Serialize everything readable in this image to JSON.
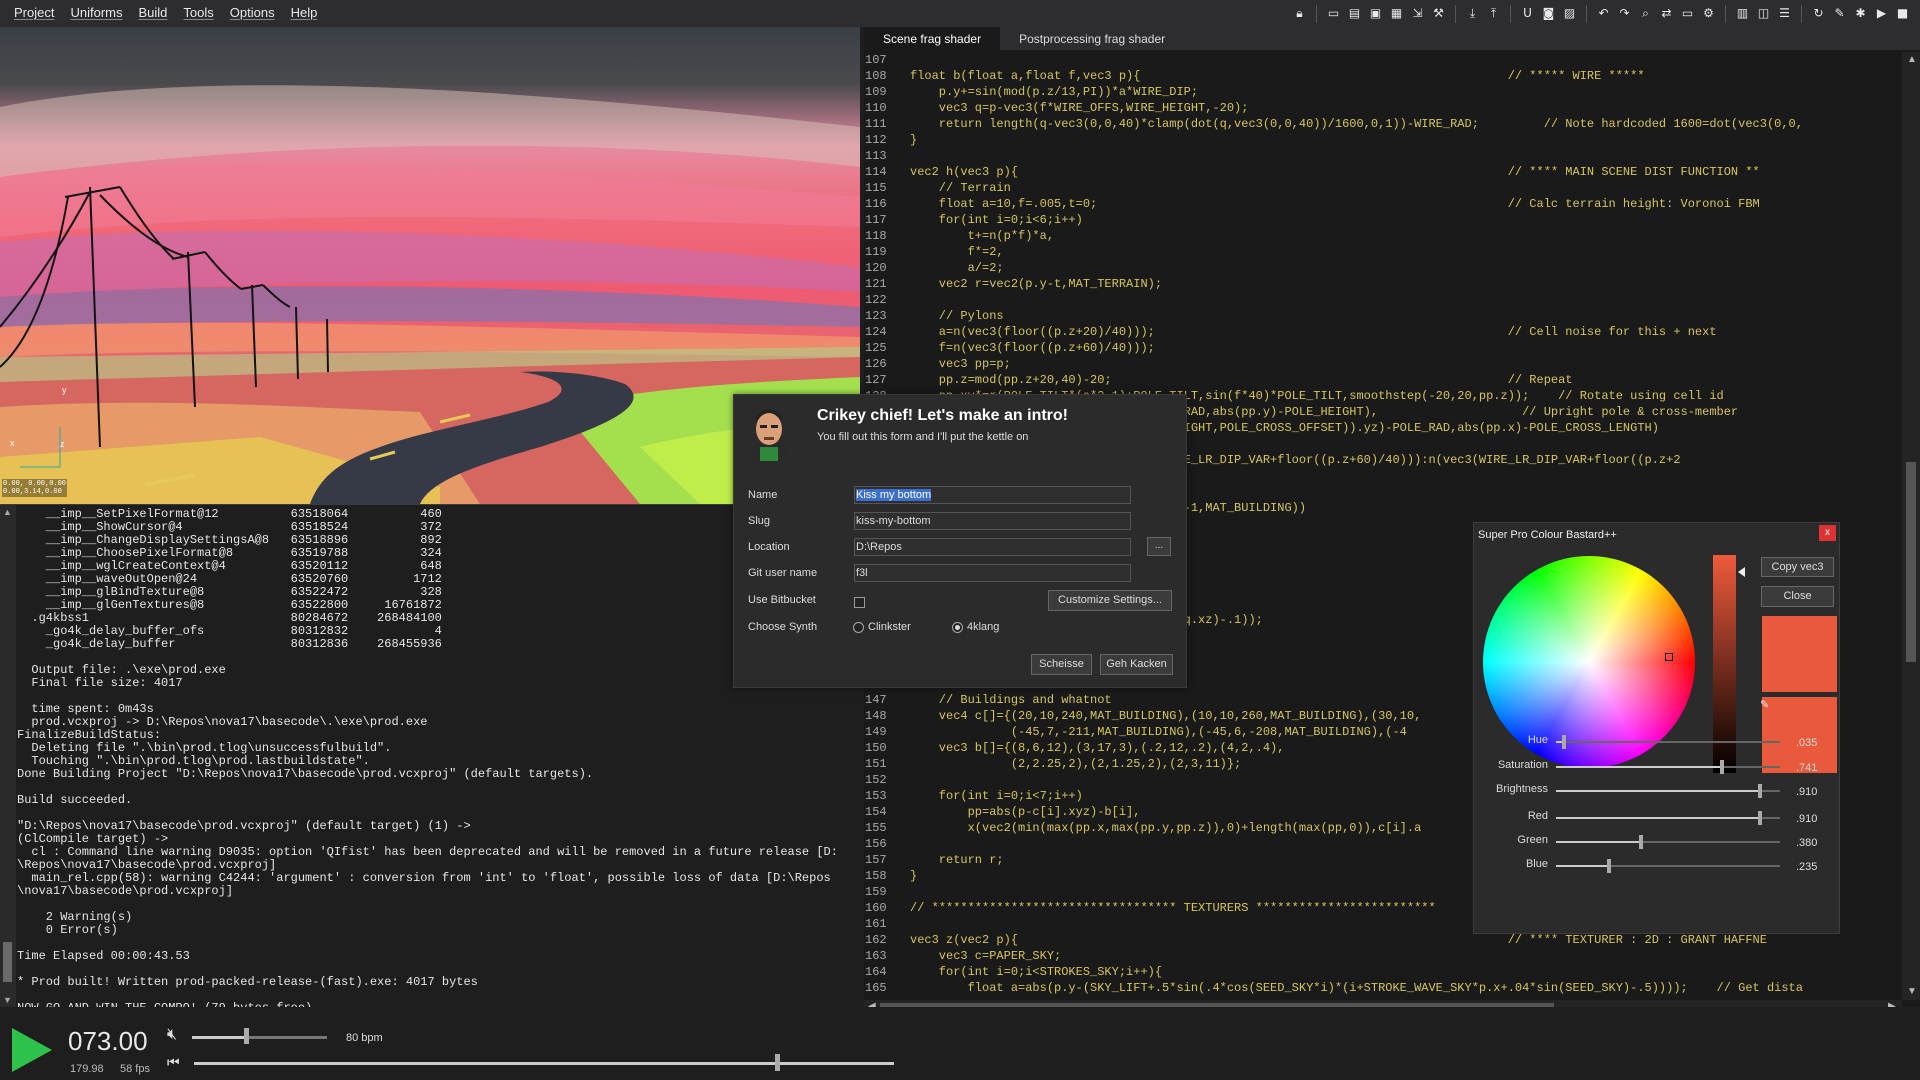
{
  "menu": [
    "Project",
    "Uniforms",
    "Build",
    "Tools",
    "Options",
    "Help"
  ],
  "toolbar_icons": [
    "lock-icon",
    "new-file-icon",
    "open-icon",
    "save-icon",
    "save-as-icon",
    "export-icon",
    "build-icon",
    "pin-icon",
    "reload-icon",
    "underline-icon",
    "camera-icon",
    "image-icon",
    "undo-icon",
    "redo-icon",
    "search-icon",
    "replace-icon",
    "monitor-icon",
    "settings-icon",
    "layout-icon",
    "split-icon",
    "list-icon",
    "refresh-icon",
    "wrench-icon",
    "bug-icon",
    "play-icon",
    "stop-icon"
  ],
  "viewport": {
    "coords_line1": "0.00, 0.00,0.00",
    "coords_line2": "0.00,3.14,0.00",
    "axis_x": "x",
    "axis_y": "y",
    "axis_z": "z"
  },
  "console": {
    "lines": [
      "    __imp__SetPixelFormat@12          63518064          460",
      "    __imp__ShowCursor@4               63518524          372",
      "    __imp__ChangeDisplaySettingsA@8   63518896          892",
      "    __imp__ChoosePixelFormat@8        63519788          324",
      "    __imp__wglCreateContext@4         63520112          648",
      "    __imp__waveOutOpen@24             63520760         1712",
      "    __imp__glBindTexture@8            63522472          328",
      "    __imp__glGenTextures@8            63522800     16761872",
      "  .g4kbss1                            80284672    268484100",
      "    _go4k_delay_buffer_ofs            80312832            4",
      "    _go4k_delay_buffer                80312836    268455936",
      "",
      "  Output file: .\\exe\\prod.exe",
      "  Final file size: 4017",
      "",
      "  time spent: 0m43s",
      "  prod.vcxproj -> D:\\Repos\\nova17\\basecode\\.\\exe\\prod.exe",
      "FinalizeBuildStatus:",
      "  Deleting file \".\\bin\\prod.tlog\\unsuccessfulbuild\".",
      "  Touching \".\\bin\\prod.tlog\\prod.lastbuildstate\".",
      "Done Building Project \"D:\\Repos\\nova17\\basecode\\prod.vcxproj\" (default targets).",
      "",
      "Build succeeded.",
      "",
      "\"D:\\Repos\\nova17\\basecode\\prod.vcxproj\" (default target) (1) ->",
      "(ClCompile target) ->",
      "  cl : Command line warning D9035: option 'QIfist' has been deprecated and will be removed in a future release [D:",
      "\\Repos\\nova17\\basecode\\prod.vcxproj]",
      "  main_rel.cpp(58): warning C4244: 'argument' : conversion from 'int' to 'float', possible loss of data [D:\\Repos",
      "\\nova17\\basecode\\prod.vcxproj]",
      "",
      "    2 Warning(s)",
      "    0 Error(s)",
      "",
      "Time Elapsed 00:00:43.53",
      "",
      "* Prod built! Written prod-packed-release-(fast).exe: 4017 bytes",
      "",
      "NOW GO AND WIN THE COMPO! (79 bytes free)"
    ]
  },
  "editor": {
    "tabs": [
      "Scene frag shader",
      "Postprocessing frag shader"
    ],
    "active_tab": 0,
    "lines": [
      {
        "n": "107",
        "t": ""
      },
      {
        "n": "108",
        "t": "float b(float a,float f,vec3 p){                                                   // ***** WIRE *****"
      },
      {
        "n": "109",
        "t": "    p.y+=sin(mod(p.z/13,PI))*a*WIRE_DIP;"
      },
      {
        "n": "110",
        "t": "    vec3 q=p-vec3(f*WIRE_OFFS,WIRE_HEIGHT,-20);"
      },
      {
        "n": "111",
        "t": "    return length(q-vec3(0,0,40)*clamp(dot(q,vec3(0,0,40))/1600,0,1))-WIRE_RAD;         // Note hardcoded 1600=dot(vec3(0,0,"
      },
      {
        "n": "112",
        "t": "}"
      },
      {
        "n": "113",
        "t": ""
      },
      {
        "n": "114",
        "t": "vec2 h(vec3 p){                                                                    // **** MAIN SCENE DIST FUNCTION **"
      },
      {
        "n": "115",
        "t": "    // Terrain"
      },
      {
        "n": "116",
        "t": "    float a=10,f=.005,t=0;                                                         // Calc terrain height: Voronoi FBM"
      },
      {
        "n": "117",
        "t": "    for(int i=0;i<6;i++)"
      },
      {
        "n": "118",
        "t": "        t+=n(p*f)*a,"
      },
      {
        "n": "119",
        "t": "        f*=2,"
      },
      {
        "n": "120",
        "t": "        a/=2;"
      },
      {
        "n": "121",
        "t": "    vec2 r=vec2(p.y-t,MAT_TERRAIN);"
      },
      {
        "n": "122",
        "t": ""
      },
      {
        "n": "123",
        "t": "    // Pylons"
      },
      {
        "n": "124",
        "t": "    a=n(vec3(floor((p.z+20)/40)));                                                 // Cell noise for this + next"
      },
      {
        "n": "125",
        "t": "    f=n(vec3(floor((p.z+60)/40)));"
      },
      {
        "n": "126",
        "t": "    vec3 pp=p;"
      },
      {
        "n": "127",
        "t": "    pp.z=mod(pp.z+20,40)-20;                                                       // Repeat"
      },
      {
        "n": "128",
        "t": "    pp.xy*=r(POLE_TILT*(a*2-1)+POLE_TILT,sin(f*40)*POLE_TILT,smoothstep(-20,20,pp.z));    // Rotate using cell id"
      },
      {
        "n": "129",
        "t": "    r=m(r,vec2(min(max(abs(pp.x)-POLE_RAD,abs(pp.y)-POLE_HEIGHT),                    // Upright pole & cross-member"
      },
      {
        "n": "130",
        "t": "        length(pp-vec3(0,POLE_CROSS_HEIGHT,POLE_CROSS_OFFSET)).yz)-POLE_RAD,abs(pp.x)-POLE_CROSS_LENGTH)"
      },
      {
        "n": "131",
        "t": ""
      },
      {
        "n": "132",
        "t": "    r=m(r,vec2(min(b(pp.z>0?n(vec3(WIRE_LR_DIP_VAR+floor((p.z+60)/40))):n(vec3(WIRE_LR_DIP_VAR+floor((p.z+2"
      },
      {
        "n": "133",
        "t": ""
      },
      {
        "n": "134",
        "t": ""
      },
      {
        "n": "135",
        "t": "    r=m(r,vec2(max(p.y-POLE_HEIGHT,0))-1,MAT_BUILDING))"
      },
      {
        "n": "136",
        "t": ""
      },
      {
        "n": "137",
        "t": ""
      },
      {
        "n": "138",
        "t": ""
      },
      {
        "n": "139",
        "t": ""
      },
      {
        "n": "140",
        "t": ""
      },
      {
        "n": "141",
        "t": ""
      },
      {
        "n": "142",
        "t": "    r=m(r,vec2(q.y-WIRE_HEIGHT,length(q.xz)-.1));"
      },
      {
        "n": "143",
        "t": ""
      },
      {
        "n": "144",
        "t": ""
      },
      {
        "n": "145",
        "t": ""
      },
      {
        "n": "146",
        "t": ""
      },
      {
        "n": "147",
        "t": "    // Buildings and whatnot"
      },
      {
        "n": "148",
        "t": "    vec4 c[]={(20,10,240,MAT_BUILDING),(10,10,260,MAT_BUILDING),(30,10,                             // M"
      },
      {
        "n": "149",
        "t": "              (-45,7,-211,MAT_BUILDING),(-45,6,-208,MAT_BUILDING),(-4                               // T"
      },
      {
        "n": "150",
        "t": "    vec3 b[]={(8,6,12),(3,17,3),(.2,12,.2),(4,2,.4),                                          // T"
      },
      {
        "n": "151",
        "t": "              (2,2.25,2),(2,1.25,2),(2,3,11)};                                               // T"
      },
      {
        "n": "152",
        "t": ""
      },
      {
        "n": "153",
        "t": "    for(int i=0;i<7;i++)"
      },
      {
        "n": "154",
        "t": "        pp=abs(p-c[i].xyz)-b[i],"
      },
      {
        "n": "155",
        "t": "        x(vec2(min(max(pp.x,max(pp.y,pp.z)),0)+length(max(pp,0)),c[i].a"
      },
      {
        "n": "156",
        "t": ""
      },
      {
        "n": "157",
        "t": "    return r;"
      },
      {
        "n": "158",
        "t": "}"
      },
      {
        "n": "159",
        "t": ""
      },
      {
        "n": "160",
        "t": "// ********************************** TEXTURERS *************************"
      },
      {
        "n": "161",
        "t": ""
      },
      {
        "n": "162",
        "t": "vec3 z(vec2 p){                                                                    // **** TEXTURER : 2D : GRANT HAFFNE"
      },
      {
        "n": "163",
        "t": "    vec3 c=PAPER_SKY;"
      },
      {
        "n": "164",
        "t": "    for(int i=0;i<STROKES_SKY;i++){"
      },
      {
        "n": "165",
        "t": "        float a=abs(p.y-(SKY_LIFT+.5*sin(.4*cos(SEED_SKY*i)*(i+STROKE_WAVE_SKY*p.x+.04*sin(SEED_SKY)-.5))));    // Get dista"
      }
    ]
  },
  "transport": {
    "time": "073.00",
    "sub_time": "179.98",
    "fps": "58 fps",
    "bpm": "80 bpm",
    "volume": 0.4,
    "position": 0.83
  },
  "intro_dialog": {
    "title": "Crikey chief! Let's make an intro!",
    "subtitle": "You fill out this form and I'll put the kettle on",
    "name_label": "Name",
    "name_value": "Kiss my bottom",
    "slug_label": "Slug",
    "slug_value": "kiss-my-bottom",
    "location_label": "Location",
    "location_value": "D:\\Repos",
    "browse_label": "...",
    "git_label": "Git user name",
    "git_value": "f3l",
    "bitbucket_label": "Use Bitbucket",
    "customize_label": "Customize Settings...",
    "synth_label": "Choose Synth",
    "synth_options": [
      "Clinkster",
      "4klang"
    ],
    "synth_selected": 1,
    "cancel_label": "Scheisse",
    "ok_label": "Geh Kacken"
  },
  "color_picker": {
    "title": "Super Pro Colour Bastard++",
    "close_x": "x",
    "copy_label": "Copy vec3",
    "close_label": "Close",
    "color": "#e85a3b",
    "sliders": [
      {
        "label": "Hue",
        "value": ".035",
        "level": 0.035
      },
      {
        "label": "Saturation",
        "value": ".741",
        "level": 0.741
      },
      {
        "label": "Brightness",
        "value": ".910",
        "level": 0.91
      },
      {
        "label": "Red",
        "value": ".910",
        "level": 0.91
      },
      {
        "label": "Green",
        "value": ".380",
        "level": 0.38
      },
      {
        "label": "Blue",
        "value": ".235",
        "level": 0.235
      }
    ]
  }
}
